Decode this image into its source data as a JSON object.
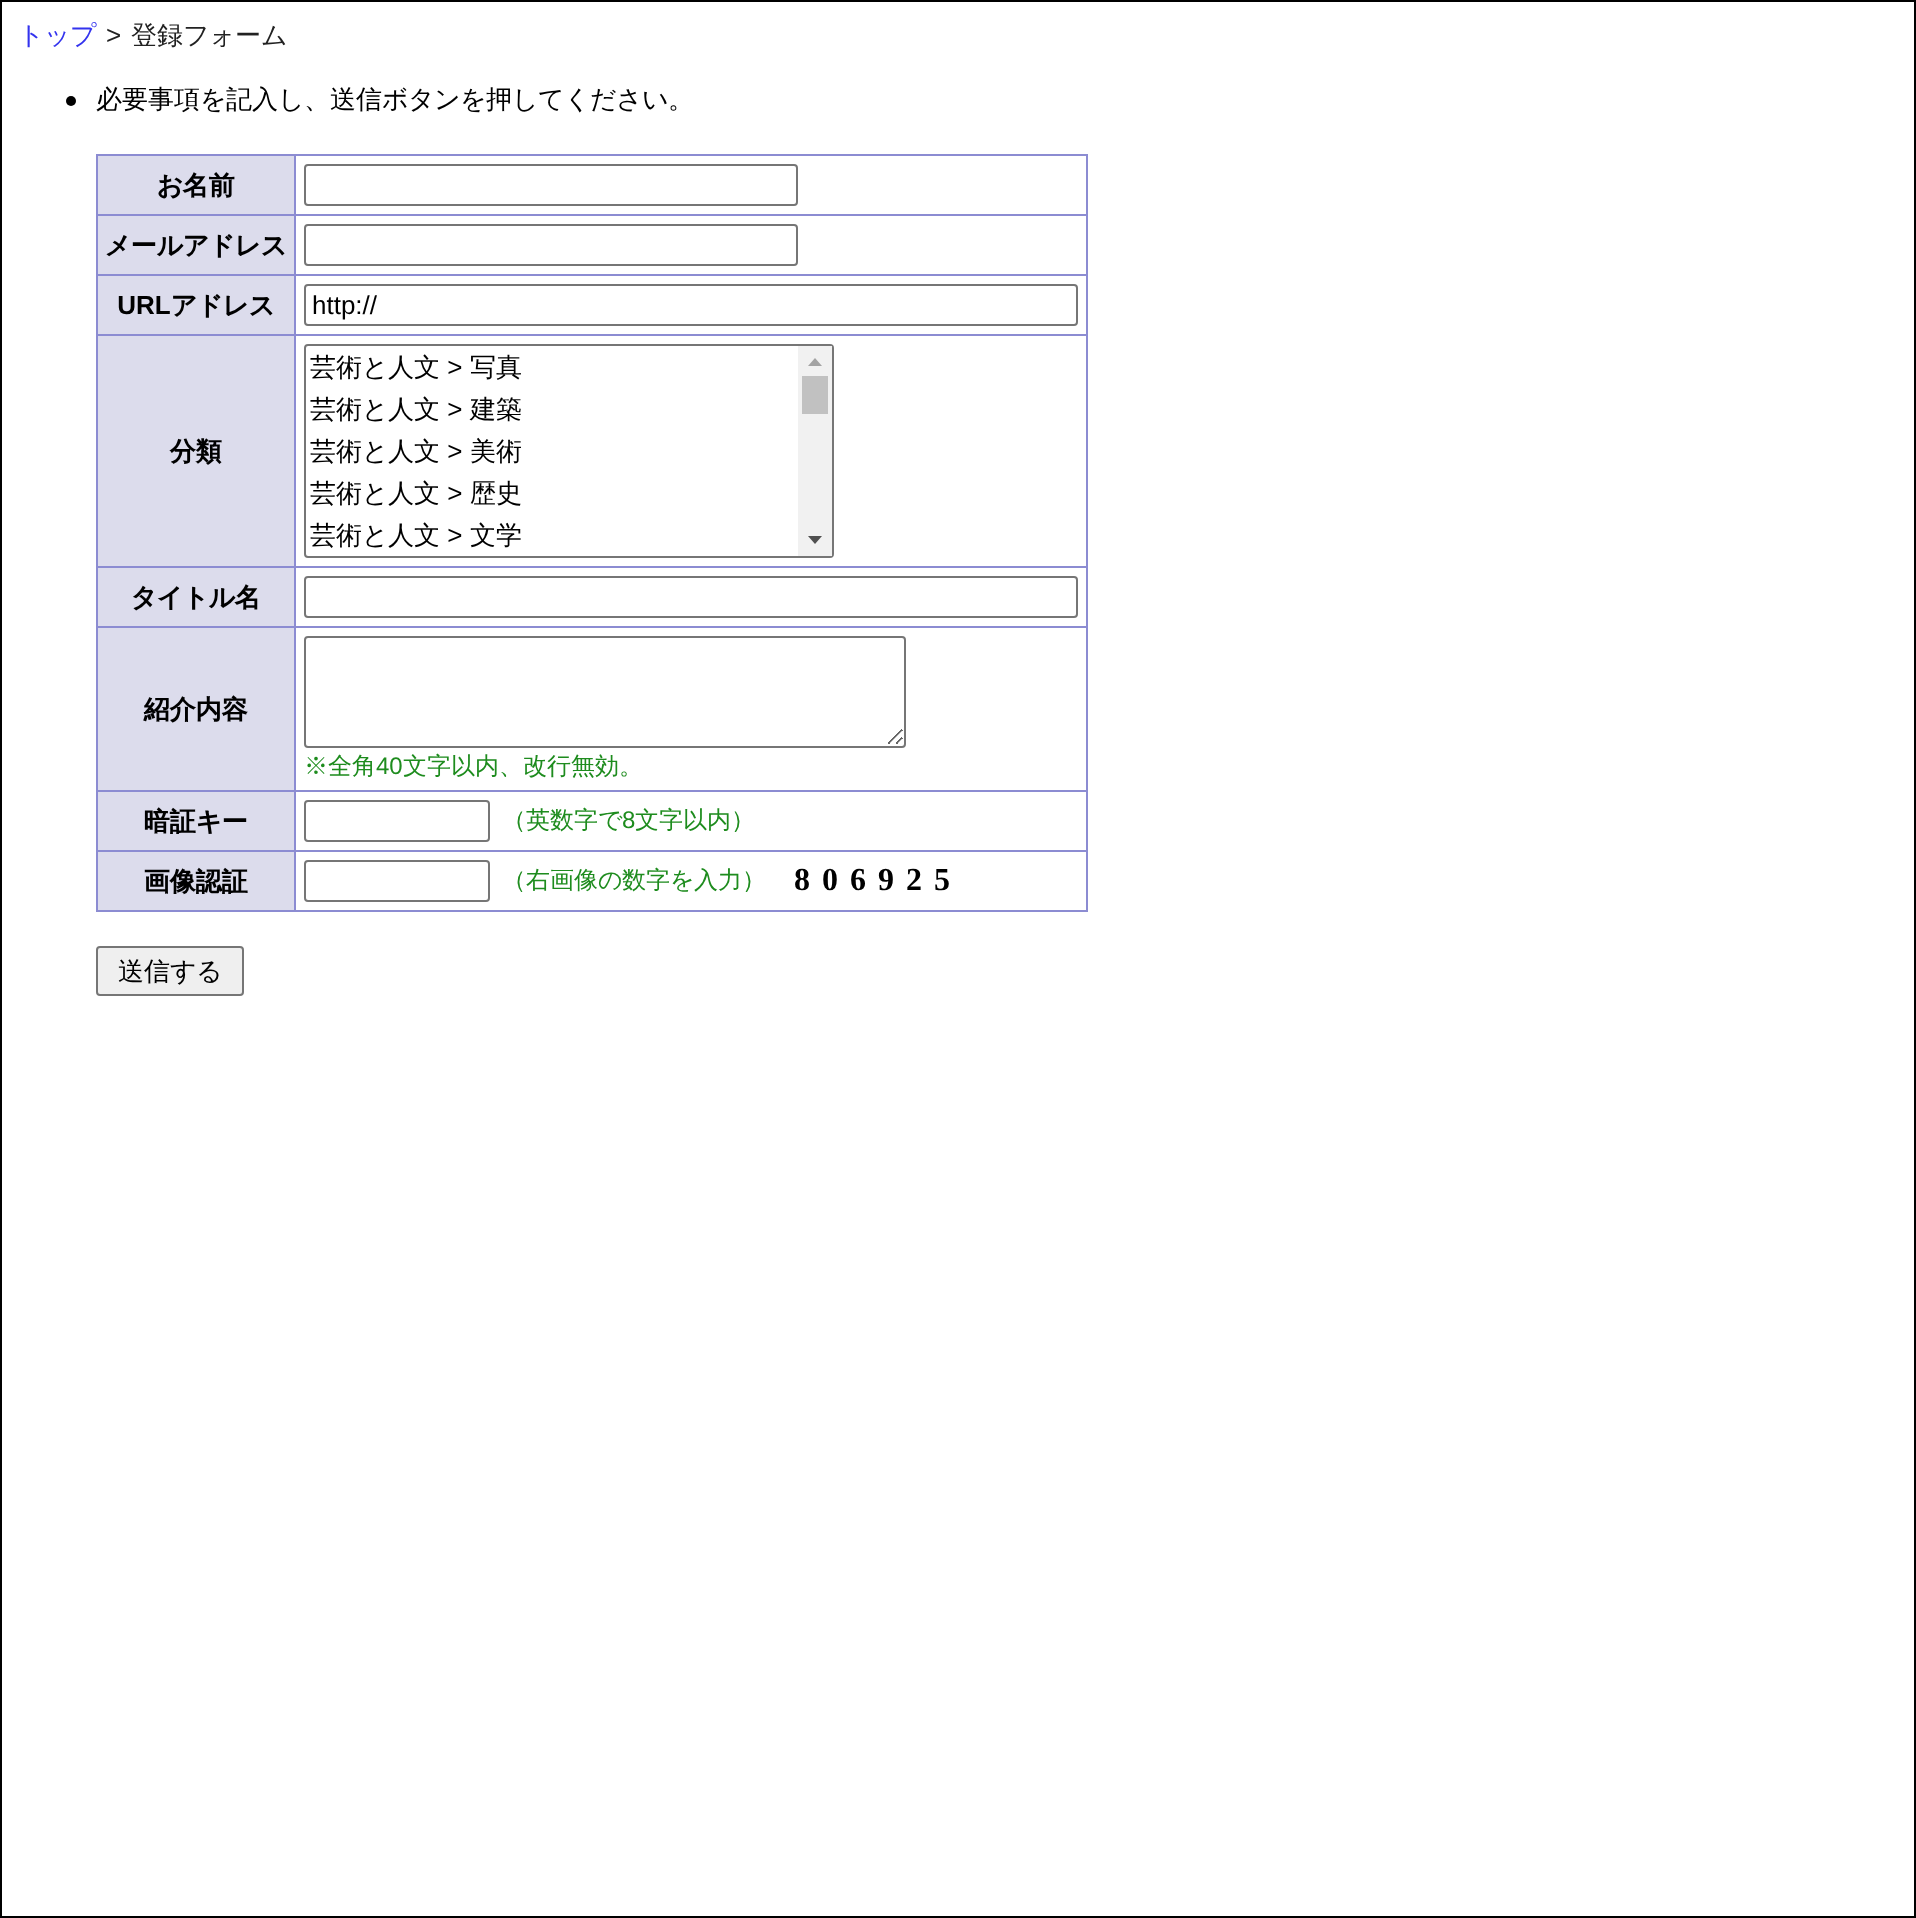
{
  "breadcrumb": [
    {
      "kind": "link",
      "label": "トップ"
    },
    {
      "kind": "separator",
      "label": ">"
    },
    {
      "kind": "current",
      "label": "登録フォーム"
    }
  ],
  "instructions": [
    "必要事項を記入し、送信ボタンを押してください。"
  ],
  "form": {
    "rows": [
      {
        "kind": "name",
        "label": "お名前"
      },
      {
        "kind": "email",
        "label": "メールアドレス"
      },
      {
        "kind": "url",
        "label": "URLアドレス",
        "value": "http://"
      },
      {
        "kind": "category",
        "label": "分類",
        "options": [
          {
            "label": "芸術と人文 > 写真",
            "selected": false
          },
          {
            "label": "芸術と人文 > 建築",
            "selected": false
          },
          {
            "label": "芸術と人文 > 美術",
            "selected": false
          },
          {
            "label": "芸術と人文 > 歴史",
            "selected": false
          },
          {
            "label": "芸術と人文 > 文学",
            "selected": false
          }
        ]
      },
      {
        "kind": "title",
        "label": "タイトル名"
      },
      {
        "kind": "description",
        "label": "紹介内容",
        "note": "※全角40文字以内、改行無効。"
      },
      {
        "kind": "passkey",
        "label": "暗証キー",
        "hint": "（英数字で8文字以内）"
      },
      {
        "kind": "captcha",
        "label": "画像認証",
        "hint": "（右画像の数字を入力）",
        "captcha": "806925"
      }
    ],
    "submit": "送信する"
  }
}
